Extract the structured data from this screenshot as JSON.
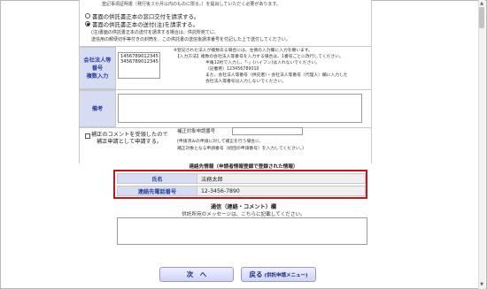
{
  "top_note": "登記事項証明書（発行後３か月以内のものに限る。）を提出していただく必要があります。",
  "delivery": {
    "option_window": "書面の供託書正本の窓口交付を請求する。",
    "option_mail": "書面の供託書正本の送付(注)を請求する。",
    "selected": "mail",
    "note_line1": "(注)書面の供託書正本の送付を請求する場合は、供託所宛てに、",
    "note_line2": "送信用の郵便切手等付きの封筒を、この供託書の送信後請求番号を付記した上で送付してください。"
  },
  "corp_number": {
    "label_line1": "会社法人等",
    "label_line2": "番号",
    "label_line3": "複数入力",
    "values": [
      "1456789012345",
      "3456789012345"
    ],
    "hint1": "※登記された法人が複数ある場合には、左側の入力欄に入力を願います。",
    "hint2": "【入力方法】複数の会社法人等番号を入力する場合は、1番号ごとに改行してください。",
    "hint3": "半角12桁で入力し、「-」(ハイフン)は入れないでください。",
    "hint4": "（記載例）123456789010",
    "hint5": "また、会社法人等番号（供託者）・会社法人等番号（代理人）欄に入力した",
    "hint6": "会社法人等番号は入力しないでください。"
  },
  "remarks": {
    "label": "備考",
    "value": ""
  },
  "correction": {
    "checkbox_line1": "補正のコメントを受領したので",
    "checkbox_line2": "補正申請として申請する。",
    "field_label": "補正対象申請番号",
    "field_value": "",
    "hint1": "(申請済みの申請に対して補正を行う場合に、",
    "hint2": "補正対象となる申請番号（初回の申請番号）を入力してください。)"
  },
  "contact": {
    "title": "連絡先情報（申請者情報登録で登録された情報）",
    "name_label": "氏名",
    "name_value": "法務太郎",
    "phone_label": "連絡先電話番号",
    "phone_value": "12-3456-7890"
  },
  "communication": {
    "title": "通信（連絡・コメント）欄",
    "subtitle": "供託所宛のメッセージは、こちらに記載してください。",
    "value": ""
  },
  "buttons": {
    "next_label": "次　へ",
    "back_label": "戻る",
    "back_sub": "(供託申請メニュー)"
  }
}
